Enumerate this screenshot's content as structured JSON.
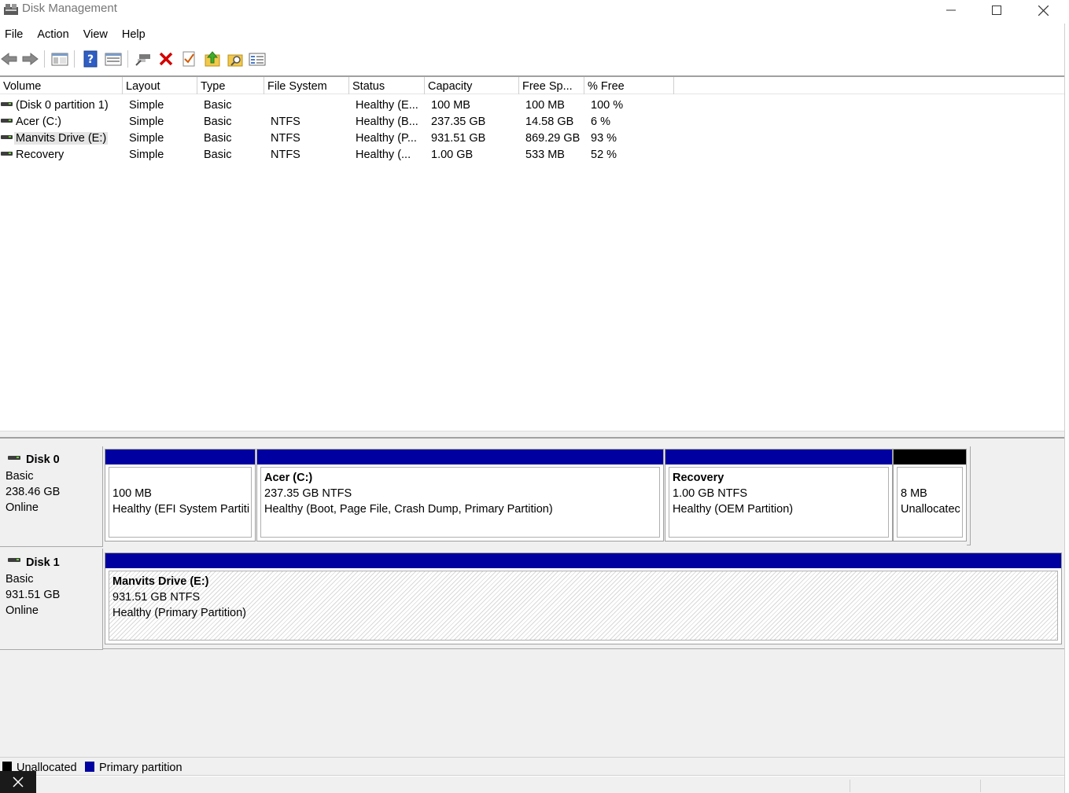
{
  "window": {
    "title": "Disk Management",
    "icon": "disk-management-icon",
    "controls": [
      "minimize-icon",
      "maximize-icon",
      "close-icon"
    ]
  },
  "menu": [
    "File",
    "Action",
    "View",
    "Help"
  ],
  "toolbar": [
    "back-icon",
    "forward-icon",
    "show-hide-console-tree-icon",
    "help-icon",
    "properties-icon",
    "connect-icon",
    "delete-icon",
    "check-icon",
    "upload-icon",
    "search-icon",
    "settings-icon"
  ],
  "columns": [
    "Volume",
    "Layout",
    "Type",
    "File System",
    "Status",
    "Capacity",
    "Free Sp...",
    "% Free"
  ],
  "volumes": [
    {
      "volume": "(Disk 0 partition 1)",
      "layout": "Simple",
      "type": "Basic",
      "fs": "",
      "status": "Healthy (E...",
      "capacity": "100 MB",
      "free": "100 MB",
      "pct": "100 %"
    },
    {
      "volume": "Acer (C:)",
      "layout": "Simple",
      "type": "Basic",
      "fs": "NTFS",
      "status": "Healthy (B...",
      "capacity": "237.35 GB",
      "free": "14.58 GB",
      "pct": "6 %"
    },
    {
      "volume": "Manvits Drive (E:)",
      "layout": "Simple",
      "type": "Basic",
      "fs": "NTFS",
      "status": "Healthy (P...",
      "capacity": "931.51 GB",
      "free": "869.29 GB",
      "pct": "93 %"
    },
    {
      "volume": "Recovery",
      "layout": "Simple",
      "type": "Basic",
      "fs": "NTFS",
      "status": "Healthy (...",
      "capacity": "1.00 GB",
      "free": "533 MB",
      "pct": "52 %"
    }
  ],
  "disks": [
    {
      "name": "Disk 0",
      "kind": "Basic",
      "size": "238.46 GB",
      "state": "Online",
      "partitions": [
        {
          "title": "",
          "size": "100 MB",
          "status": "Healthy (EFI System Partiti",
          "type": "primary"
        },
        {
          "title": "Acer  (C:)",
          "size": "237.35 GB NTFS",
          "status": "Healthy (Boot, Page File, Crash Dump, Primary Partition)",
          "type": "primary"
        },
        {
          "title": "Recovery",
          "size": "1.00 GB NTFS",
          "status": "Healthy (OEM Partition)",
          "type": "primary"
        },
        {
          "title": "",
          "size": "8 MB",
          "status": "Unallocatec",
          "type": "unallocated"
        }
      ]
    },
    {
      "name": "Disk 1",
      "kind": "Basic",
      "size": "931.51 GB",
      "state": "Online",
      "partitions": [
        {
          "title": "Manvits Drive  (E:)",
          "size": "931.51 GB NTFS",
          "status": "Healthy (Primary Partition)",
          "type": "primary"
        }
      ]
    }
  ],
  "legend": [
    {
      "label": "Unallocated",
      "color": "#000000"
    },
    {
      "label": "Primary partition",
      "color": "#0000a0"
    }
  ],
  "colors": {
    "primary": "#0000a0",
    "unallocated": "#000000",
    "background": "#f0f0f0"
  }
}
